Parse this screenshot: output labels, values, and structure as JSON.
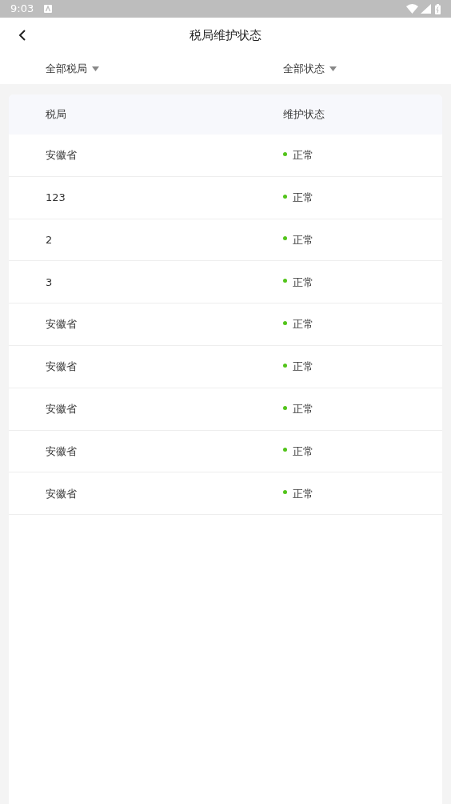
{
  "status_bar": {
    "time": "9:03"
  },
  "header": {
    "title": "税局维护状态"
  },
  "filters": [
    {
      "label": "全部税局"
    },
    {
      "label": "全部状态"
    }
  ],
  "table": {
    "columns": [
      "税局",
      "维护状态"
    ],
    "rows": [
      {
        "bureau": "安徽省",
        "status": "正常",
        "color": "#52c41a"
      },
      {
        "bureau": "123",
        "status": "正常",
        "color": "#52c41a"
      },
      {
        "bureau": "2",
        "status": "正常",
        "color": "#52c41a"
      },
      {
        "bureau": "3",
        "status": "正常",
        "color": "#52c41a"
      },
      {
        "bureau": "安徽省",
        "status": "正常",
        "color": "#52c41a"
      },
      {
        "bureau": "安徽省",
        "status": "正常",
        "color": "#52c41a"
      },
      {
        "bureau": "安徽省",
        "status": "正常",
        "color": "#52c41a"
      },
      {
        "bureau": "安徽省",
        "status": "正常",
        "color": "#52c41a"
      },
      {
        "bureau": "安徽省",
        "status": "正常",
        "color": "#52c41a"
      }
    ]
  }
}
